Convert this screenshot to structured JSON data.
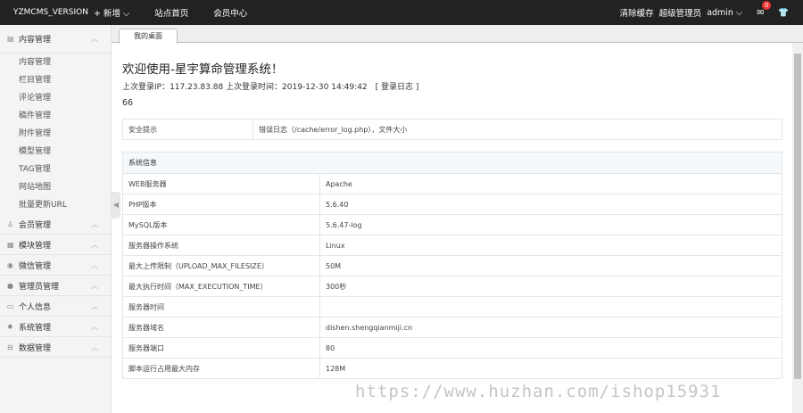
{
  "topbar": {
    "brand": "YZMCMS_VERSION",
    "add": "+ 新增 ⌵",
    "home": "站点首页",
    "member": "会员中心",
    "clear_cache": "清除缓存",
    "role": "超级管理员",
    "user": "admin ⌵",
    "msg_count": "0"
  },
  "sidebar": {
    "first": "内容管理",
    "subs": [
      "内容管理",
      "栏目管理",
      "评论管理",
      "稿件管理",
      "附件管理",
      "模型管理",
      "TAG管理",
      "网站地图",
      "批量更新URL"
    ],
    "sections": [
      {
        "label": "会员管理",
        "icon": "user-icon"
      },
      {
        "label": "模块管理",
        "icon": "grid-icon"
      },
      {
        "label": "微信管理",
        "icon": "wechat-icon"
      },
      {
        "label": "管理员管理",
        "icon": "admin-icon"
      },
      {
        "label": "个人信息",
        "icon": "card-icon"
      },
      {
        "label": "系统管理",
        "icon": "gear-icon"
      },
      {
        "label": "数据管理",
        "icon": "database-icon"
      }
    ]
  },
  "tab": "我的桌面",
  "main": {
    "title": "欢迎使用-星宇算命管理系统！",
    "login": "上次登录IP：117.23.83.88 上次登录时间：2019-12-30 14:49:42　[ 登录日志 ]",
    "number": "66",
    "security": {
      "label": "安全提示",
      "value": "错误日志（/cache/error_log.php），文件大小"
    },
    "sysinfo": {
      "header": "系统信息",
      "rows": [
        [
          "WEB服务器",
          "Apache"
        ],
        [
          "PHP版本",
          "5.6.40"
        ],
        [
          "MySQL版本",
          "5.6.47-log"
        ],
        [
          "服务器操作系统",
          "Linux"
        ],
        [
          "最大上传限制（UPLOAD_MAX_FILESIZE）",
          "50M"
        ],
        [
          "最大执行时间（MAX_EXECUTION_TIME）",
          "300秒"
        ],
        [
          "服务器时间",
          ""
        ],
        [
          "服务器域名",
          "dishen.shengqianmiji.cn"
        ],
        [
          "服务器端口",
          "80"
        ],
        [
          "脚本运行占用最大内存",
          "128M"
        ]
      ]
    }
  },
  "watermark": "https://www.huzhan.com/ishop15931"
}
